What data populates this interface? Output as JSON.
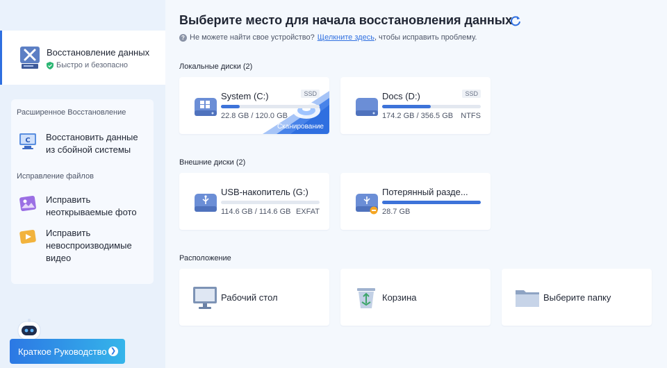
{
  "sidebar": {
    "active": {
      "title": "Восстановление данных",
      "sub": "Быстро и безопасно"
    },
    "section_advanced": "Расширенное Восстановление",
    "item_crashed": "Восстановить данные из сбойной системы",
    "section_repair": "Исправление файлов",
    "item_photo": "Исправить неоткрываемые фото",
    "item_video": "Исправить невоспроизводимые видео",
    "guide_button": "Краткое Руководство"
  },
  "main": {
    "title": "Выберите место для начала восстановления данных",
    "hint_pre": "Не можете найти свое устройство?",
    "hint_link": "Щелкните здесь",
    "hint_post": ", чтобы исправить проблему.",
    "local_group": "Локальные диски (2)",
    "external_group": "Внешние диски (2)",
    "location_group": "Расположение"
  },
  "local_disks": [
    {
      "name": "System (C:)",
      "badge": "SSD",
      "size": "22.8 GB / 120.0 GB",
      "fs": "",
      "used_fraction": 0.19,
      "scan_label": "Сканирование"
    },
    {
      "name": "Docs (D:)",
      "badge": "SSD",
      "size": "174.2 GB / 356.5 GB",
      "fs": "NTFS",
      "used_fraction": 0.49
    }
  ],
  "external_disks": [
    {
      "name": "USB-накопитель (G:)",
      "size": "114.6 GB / 114.6 GB",
      "fs": "EXFAT",
      "used_fraction": 0.0
    },
    {
      "name": "Потерянный разде...",
      "size": "28.7 GB",
      "fs": "",
      "used_fraction": 1.0
    }
  ],
  "locations": [
    {
      "name": "Рабочий стол",
      "icon": "monitor-icon"
    },
    {
      "name": "Корзина",
      "icon": "recycle-bin-icon"
    },
    {
      "name": "Выберите папку",
      "icon": "folder-icon"
    }
  ],
  "colors": {
    "accent": "#2f6fe0",
    "bar": "#3d73d9",
    "sidebar": "#e9f1fb"
  }
}
